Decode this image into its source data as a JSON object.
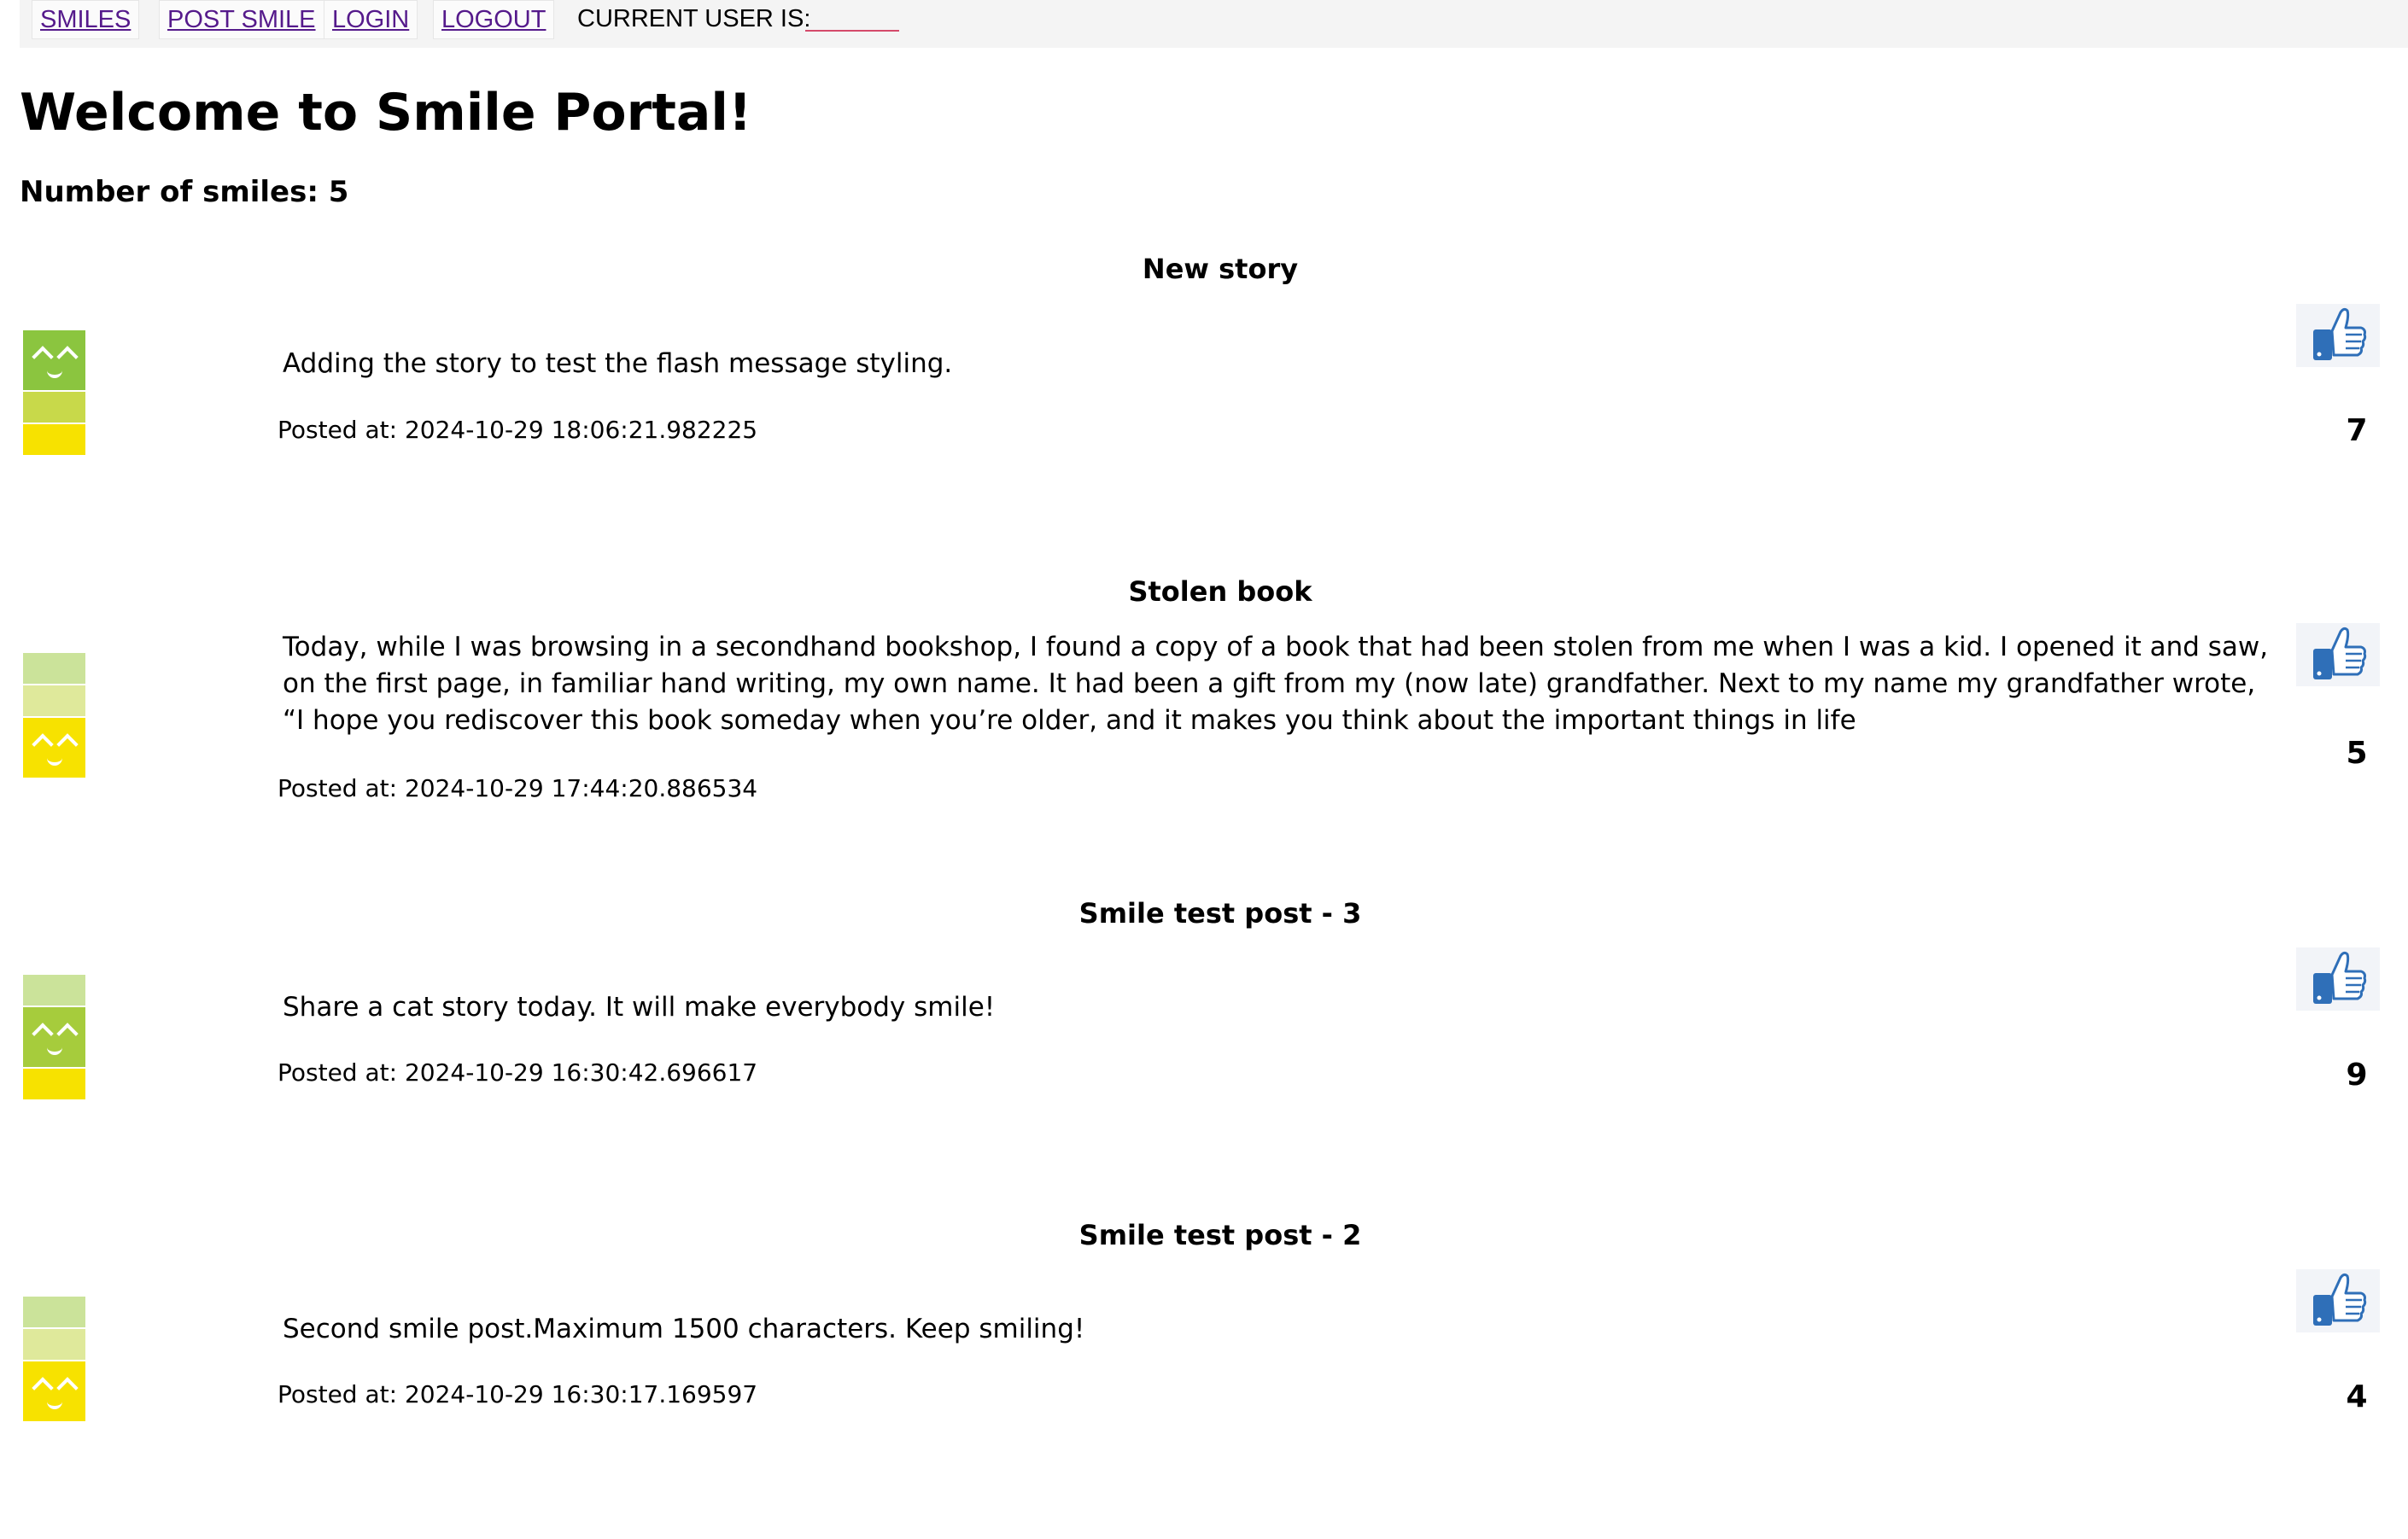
{
  "nav": {
    "items": [
      {
        "label": "SMILES"
      },
      {
        "label": "POST SMILE"
      },
      {
        "label": "LOGIN"
      },
      {
        "label": "LOGOUT"
      }
    ],
    "current_user_label": "CURRENT USER IS:",
    "current_user_value": ""
  },
  "page": {
    "title": "Welcome to Smile Portal!",
    "smile_count_text": "Number of smiles: 5"
  },
  "posts": [
    {
      "title": "New story",
      "body": "Adding the story to test the flash message styling.",
      "posted_at": "Posted at: 2024-10-29 18:06:21.982225",
      "likes": "7",
      "icon": "smile-level-high"
    },
    {
      "title": "Stolen book",
      "body": "Today, while I was browsing in a secondhand bookshop, I found a copy of a book that had been stolen from me when I was a kid. I opened it and saw, on the first page, in familiar hand writing, my own name. It had been a gift from my (now late) grandfather. Next to my name my grandfather wrote, “I hope you rediscover this book someday when you’re older, and it makes you think about the important things in life",
      "posted_at": "Posted at: 2024-10-29 17:44:20.886534",
      "likes": "5",
      "icon": "smile-level-low"
    },
    {
      "title": "Smile test post - 3",
      "body": "Share a cat story today. It will make everybody smile!",
      "posted_at": "Posted at: 2024-10-29 16:30:42.696617",
      "likes": "9",
      "icon": "smile-level-mid"
    },
    {
      "title": "Smile test post - 2",
      "body": "Second smile post.Maximum 1500 characters. Keep smiling!",
      "posted_at": "Posted at: 2024-10-29 16:30:17.169597",
      "likes": "4",
      "icon": "smile-level-low"
    }
  ],
  "icons": {
    "like": "thumbs-up-icon"
  },
  "colors": {
    "link": "#551a8b",
    "like_blue": "#2f6fb8",
    "smile_green": "#8bc53f",
    "smile_yellow": "#f7e200"
  }
}
